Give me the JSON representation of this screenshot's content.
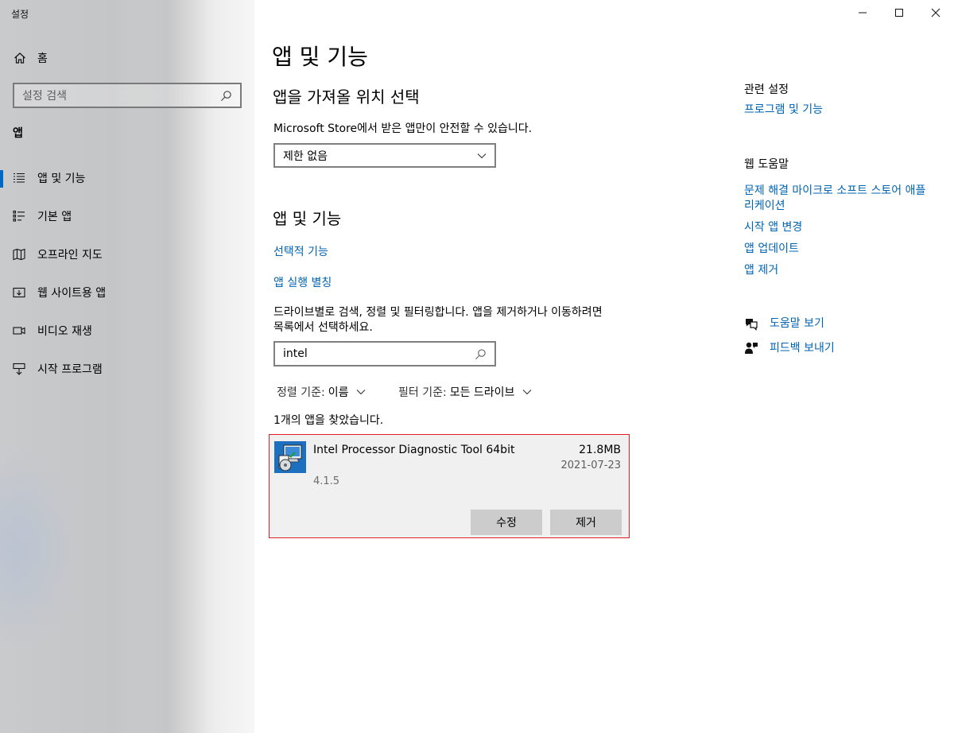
{
  "window": {
    "title": "설정"
  },
  "sidebar": {
    "home_label": "홈",
    "search_placeholder": "설정 검색",
    "section": "앱",
    "items": [
      {
        "label": "앱 및 기능",
        "icon": "apps-features-icon",
        "selected": true
      },
      {
        "label": "기본 앱",
        "icon": "default-apps-icon",
        "selected": false
      },
      {
        "label": "오프라인 지도",
        "icon": "offline-maps-icon",
        "selected": false
      },
      {
        "label": "웹 사이트용 앱",
        "icon": "apps-for-websites-icon",
        "selected": false
      },
      {
        "label": "비디오 재생",
        "icon": "video-playback-icon",
        "selected": false
      },
      {
        "label": "시작 프로그램",
        "icon": "startup-icon",
        "selected": false
      }
    ]
  },
  "main": {
    "title": "앱 및 기능",
    "install_section": {
      "heading": "앱을 가져올 위치 선택",
      "description": "Microsoft Store에서 받은 앱만이 안전할 수 있습니다.",
      "dropdown_value": "제한 없음"
    },
    "apps_section": {
      "heading": "앱 및 기능",
      "link_optional": "선택적 기능",
      "link_aliases": "앱 실행 별칭",
      "description_line1": "드라이브별로 검색, 정렬 및 필터링합니다. 앱을 제거하거나 이동하려면",
      "description_line2": "목록에서 선택하세요.",
      "search_value": "intel",
      "sort_label": "정렬 기준:",
      "sort_value": "이름",
      "filter_label": "필터 기준:",
      "filter_value": "모든 드라이브",
      "result_count": "1개의 앱을 찾았습니다."
    },
    "app": {
      "name": "Intel Processor Diagnostic Tool 64bit",
      "size": "21.8MB",
      "date": "2021-07-23",
      "version": "4.1.5",
      "modify_label": "수정",
      "uninstall_label": "제거"
    }
  },
  "right": {
    "related_heading": "관련 설정",
    "related_link": "프로그램 및 기능",
    "help_heading": "웹 도움말",
    "help_links": [
      "문제 해결 마이크로 소프트 스토어 애플 리케이션",
      "시작 앱 변경",
      "앱 업데이트",
      "앱 제거"
    ],
    "get_help": "도움말 보기",
    "feedback": "피드백 보내기"
  },
  "colors": {
    "accent": "#0063b1",
    "selection_bar": "#0067c0",
    "highlight_border": "#e41e26"
  }
}
